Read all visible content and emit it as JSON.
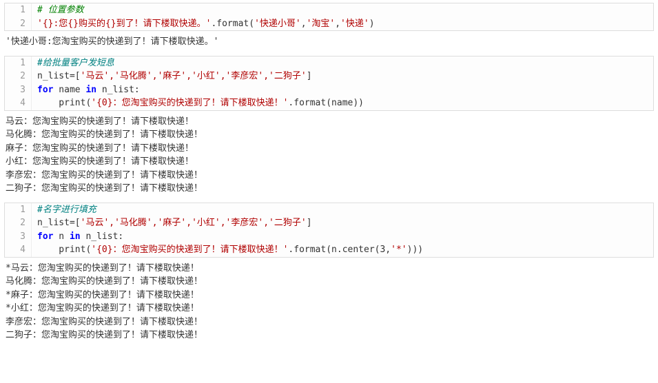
{
  "block1": {
    "line1": "# 位置参数",
    "line2_str": "'{}:您{}购买的{}到了！请下楼取快递。'",
    "line2_dot": ".format(",
    "line2_arg1": "'快递小哥'",
    "line2_comma1": ",",
    "line2_arg2": "'淘宝'",
    "line2_comma2": ",",
    "line2_arg3": "'快递'",
    "line2_close": ")"
  },
  "output1": "'快递小哥:您淘宝购买的快递到了！请下楼取快递。'",
  "block2": {
    "line1": "#给批量客户发短息",
    "line2_var": "n_list=[",
    "line2_items": "'马云','马化腾','麻子','小红','李彦宏','二狗子'",
    "line2_close": "]",
    "line3_for": "for",
    "line3_mid": " name ",
    "line3_in": "in",
    "line3_rest": " n_list:",
    "line4_indent": "    print(",
    "line4_str": "'{0}：您淘宝购买的快递到了！请下楼取快递！'",
    "line4_rest": ".format(name))"
  },
  "output2": "马云：您淘宝购买的快递到了！请下楼取快递！\n马化腾：您淘宝购买的快递到了！请下楼取快递！\n麻子：您淘宝购买的快递到了！请下楼取快递！\n小红：您淘宝购买的快递到了！请下楼取快递！\n李彦宏：您淘宝购买的快递到了！请下楼取快递！\n二狗子：您淘宝购买的快递到了！请下楼取快递！",
  "block3": {
    "line1": "#名字进行填充",
    "line2_var": "n_list=[",
    "line2_items": "'马云','马化腾','麻子','小红','李彦宏','二狗子'",
    "line2_close": "]",
    "line3_for": "for",
    "line3_mid": " n ",
    "line3_in": "in",
    "line3_rest": " n_list:",
    "line4_indent": "    print(",
    "line4_str": "'{0}：您淘宝购买的快递到了！请下楼取快递！'",
    "line4_rest1": ".format(n.center(3,",
    "line4_star": "'*'",
    "line4_rest2": ")))"
  },
  "output3": "*马云：您淘宝购买的快递到了！请下楼取快递！\n马化腾：您淘宝购买的快递到了！请下楼取快递！\n*麻子：您淘宝购买的快递到了！请下楼取快递！\n*小红：您淘宝购买的快递到了！请下楼取快递！\n李彦宏：您淘宝购买的快递到了！请下楼取快递！\n二狗子：您淘宝购买的快递到了！请下楼取快递！",
  "linenums": {
    "l1": "1",
    "l2": "2",
    "l3": "3",
    "l4": "4"
  }
}
